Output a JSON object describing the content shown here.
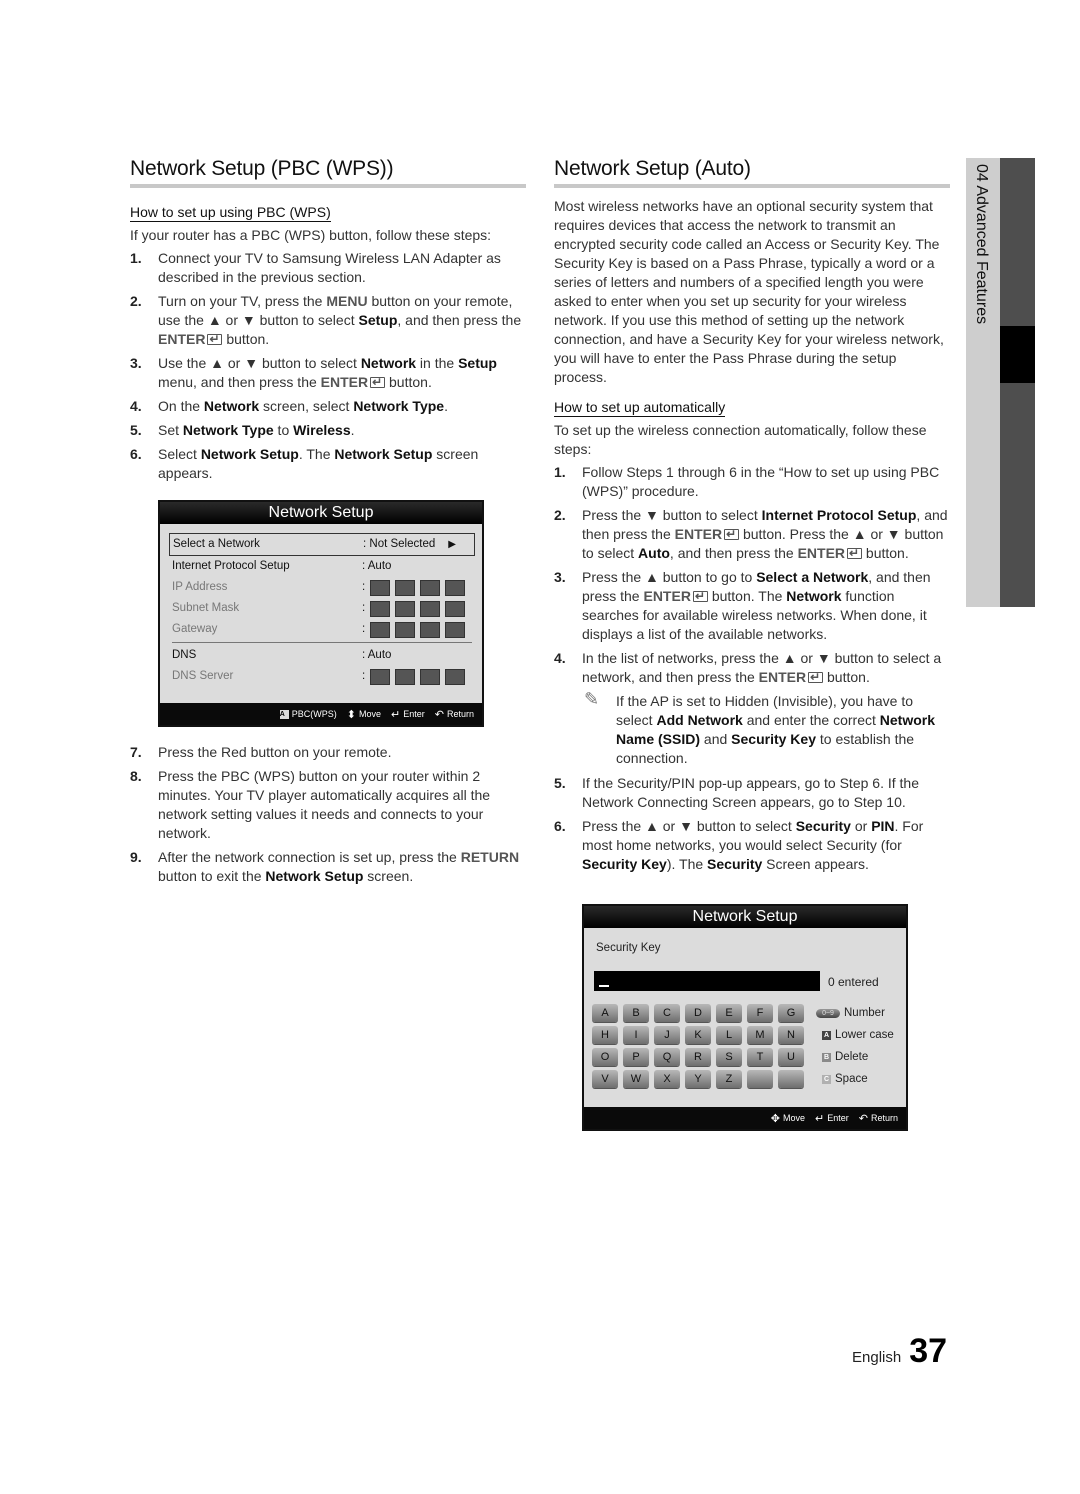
{
  "left": {
    "title": "Network Setup (PBC (WPS))",
    "subhead": "How to set up using PBC (WPS)",
    "intro": "If your router has a PBC (WPS) button, follow these steps:",
    "steps_a": [
      {
        "num": "1.",
        "html": "Connect your TV to Samsung Wireless LAN Adapter as described in the previous section."
      },
      {
        "num": "2.",
        "html": "Turn on your TV, press the <b class='g'>MENU</b> button on your remote, use the ▲ or ▼ button to select <b class='k'>Setup</b>, and then press the <b class='g'>ENTER</b><span class='enter-ico'></span> button."
      },
      {
        "num": "3.",
        "html": "Use the ▲ or ▼ button to select <b class='k'>Network</b> in the <b class='k'>Setup</b> menu, and then press the <b class='g'>ENTER</b><span class='enter-ico'></span> button."
      },
      {
        "num": "4.",
        "html": "On the <b class='k'>Network</b> screen, select <b class='k'>Network Type</b>."
      },
      {
        "num": "5.",
        "html": "Set <b class='k'>Network Type</b> to <b class='k'>Wireless</b>."
      },
      {
        "num": "6.",
        "html": "Select <b class='k'>Network Setup</b>. The <b class='k'>Network Setup</b> screen appears."
      }
    ],
    "steps_b": [
      {
        "num": "7.",
        "html": "Press the Red button on your remote."
      },
      {
        "num": "8.",
        "html": "Press the PBC (WPS) button on your router within 2 minutes. Your TV player automatically acquires all the network setting values it needs and connects to your network."
      },
      {
        "num": "9.",
        "html": "After the network connection is set up, press the <b class='g'>RETURN</b> button to exit the <b class='k'>Network Setup</b> screen."
      }
    ]
  },
  "tv1": {
    "title": "Network Setup",
    "rows": [
      {
        "label": "Select a Network",
        "value": ": Not Selected",
        "arrow": "▶",
        "selected": true
      },
      {
        "label": "Internet Protocol Setup",
        "value": ": Auto"
      },
      {
        "label": "IP Address",
        "value": ":",
        "blocks": true,
        "dim": true
      },
      {
        "label": "Subnet Mask",
        "value": ":",
        "blocks": true,
        "dim": true
      },
      {
        "label": "Gateway",
        "value": ":",
        "blocks": true,
        "dim": true
      },
      {
        "label": "DNS",
        "value": ": Auto",
        "divider_before": true
      },
      {
        "label": "DNS Server",
        "value": ":",
        "blocks": true,
        "dim": true
      }
    ],
    "footer": [
      {
        "icon": "a-button-icon",
        "glyph": "A",
        "label": "PBC(WPS)"
      },
      {
        "icon": "up-down-arrow-icon",
        "glyph": "⬍",
        "label": "Move"
      },
      {
        "icon": "enter-icon",
        "glyph": "↵",
        "label": "Enter"
      },
      {
        "icon": "return-icon",
        "glyph": "↶",
        "label": "Return"
      }
    ]
  },
  "right": {
    "title": "Network Setup (Auto)",
    "intro": "Most wireless networks have an optional security system that requires devices that access the network to transmit an encrypted security code called an Access or Security Key. The Security Key is based on a Pass Phrase, typically a word or a series of letters and numbers of a specified length you were asked to enter when you set up security for your wireless network.  If you use this method of setting up the network connection, and have a Security Key for your wireless network, you will have to enter the Pass Phrase during the setup process.",
    "subhead": "How to set up automatically",
    "lead": "To set up the wireless connection automatically, follow these steps:",
    "steps_a": [
      {
        "num": "1.",
        "html": "Follow Steps 1 through 6 in the “How to set up using PBC (WPS)” procedure."
      },
      {
        "num": "2.",
        "html": "Press the ▼ button to select <b class='k'>Internet Protocol Setup</b>, and then press the <b class='g'>ENTER</b><span class='enter-ico'></span> button. Press the ▲ or ▼ button to select <b class='k'>Auto</b>, and then press the <b class='g'>ENTER</b><span class='enter-ico'></span> button."
      },
      {
        "num": "3.",
        "html": "Press the ▲ button to go to <b class='k'>Select a Network</b>, and then press the <b class='g'>ENTER</b><span class='enter-ico'></span> button. The <b class='k'>Network</b> function searches for available wireless networks. When done, it displays a list of the available networks."
      },
      {
        "num": "4.",
        "html": "In the list of networks, press the ▲ or ▼ button to select a network, and then press the <b class='g'>ENTER</b><span class='enter-ico'></span> button."
      }
    ],
    "note": "If the AP is set to Hidden (Invisible), you have to select <b class='k'>Add Network</b> and enter the correct <b class='k'>Network Name (SSID)</b> and <b class='k'>Security Key</b> to establish the connection.",
    "steps_b": [
      {
        "num": "5.",
        "html": "If the Security/PIN pop-up appears, go to Step 6. If the Network Connecting Screen appears, go to Step 10."
      },
      {
        "num": "6.",
        "html": "Press the ▲ or ▼ button to select <b class='k'>Security</b> or <b class='k'>PIN</b>. For most home networks, you would select Security (for <b class='k'>Security Key</b>). The <b class='k'>Security</b> Screen appears."
      }
    ]
  },
  "tv2": {
    "title": "Network Setup",
    "field_label": "Security Key",
    "field_value": "",
    "count": "0 entered",
    "keys": [
      "A",
      "B",
      "C",
      "D",
      "E",
      "F",
      "G",
      "H",
      "I",
      "J",
      "K",
      "L",
      "M",
      "N",
      "O",
      "P",
      "Q",
      "R",
      "S",
      "T",
      "U",
      "V",
      "W",
      "X",
      "Y",
      "Z",
      "",
      ""
    ],
    "legend": [
      {
        "icon": "number-pill-icon",
        "glyph": "0~9",
        "label": "Number"
      },
      {
        "icon": "a-button-icon",
        "glyph": "A",
        "label": "Lower case",
        "color": "#444444"
      },
      {
        "icon": "b-button-icon",
        "glyph": "B",
        "label": "Delete",
        "color": "#8a8a8a"
      },
      {
        "icon": "c-button-icon",
        "glyph": "C",
        "label": "Space",
        "color": "#b0b0b0"
      }
    ],
    "footer": [
      {
        "icon": "four-way-arrow-icon",
        "glyph": "✥",
        "label": "Move"
      },
      {
        "icon": "enter-icon",
        "glyph": "↵",
        "label": "Enter"
      },
      {
        "icon": "return-icon",
        "glyph": "↶",
        "label": "Return"
      }
    ]
  },
  "side_tab": {
    "label": "04  Advanced Features"
  },
  "footer": {
    "language": "English",
    "page": "37"
  }
}
